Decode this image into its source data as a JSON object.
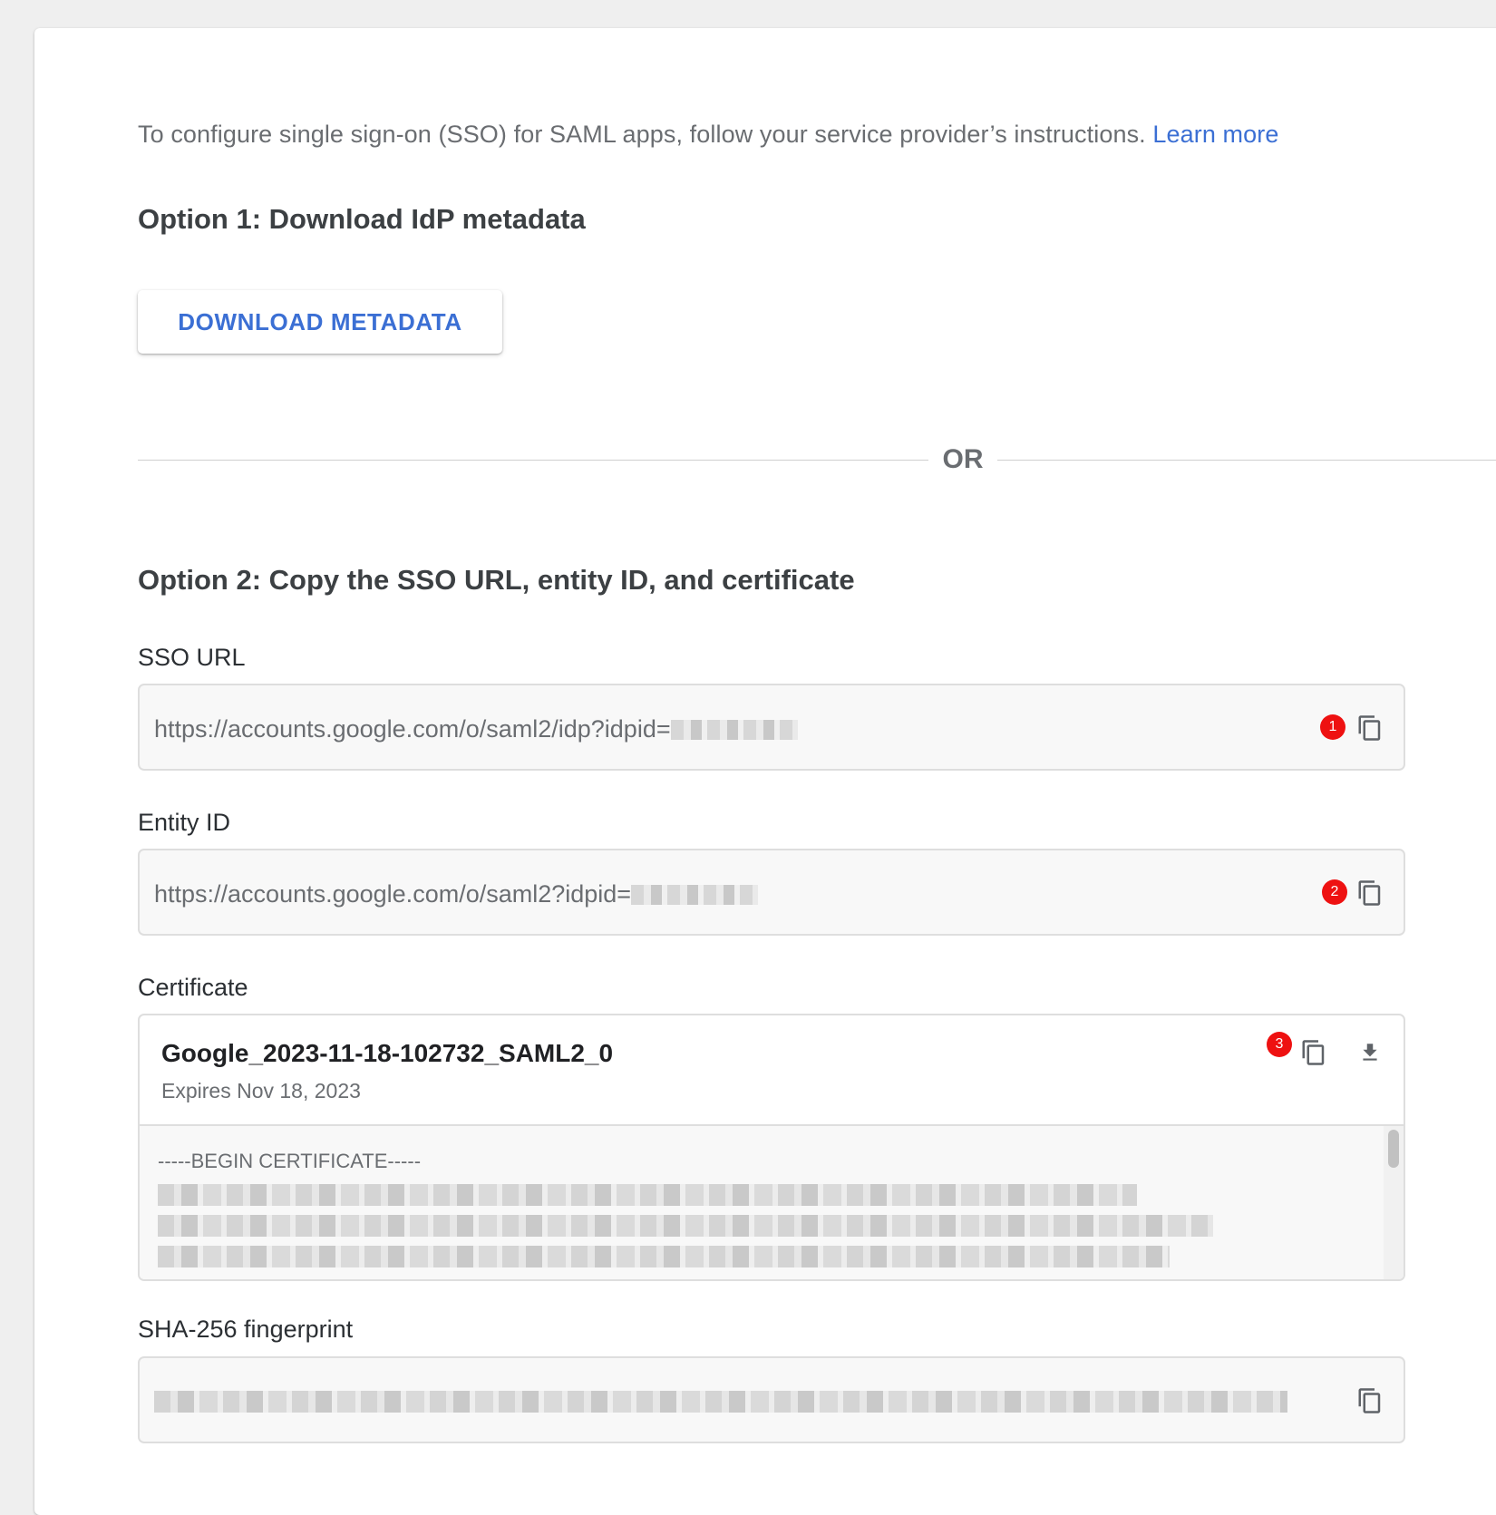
{
  "intro": {
    "text": "To configure single sign-on (SSO) for SAML apps, follow your service provider’s instructions.",
    "learn_more": "Learn more"
  },
  "option1": {
    "title": "Option 1: Download IdP metadata",
    "download_button": "DOWNLOAD METADATA"
  },
  "divider": {
    "text": "OR"
  },
  "option2": {
    "title": "Option 2: Copy the SSO URL, entity ID, and certificate",
    "sso_url": {
      "label": "SSO URL",
      "value": "https://accounts.google.com/o/saml2/idp?idpid=",
      "badge": "1"
    },
    "entity_id": {
      "label": "Entity ID",
      "value": "https://accounts.google.com/o/saml2?idpid=",
      "badge": "2"
    },
    "certificate": {
      "label": "Certificate",
      "name": "Google_2023-11-18-102732_SAML2_0",
      "expires": "Expires Nov 18, 2023",
      "begin": "-----BEGIN CERTIFICATE-----",
      "badge": "3"
    },
    "fingerprint": {
      "label": "SHA-256 fingerprint"
    }
  },
  "icons": {
    "copy": "copy-icon",
    "download": "download-icon"
  },
  "colors": {
    "link": "#3b6fd4",
    "badge": "#ee1111",
    "page_bg": "#efefef"
  }
}
